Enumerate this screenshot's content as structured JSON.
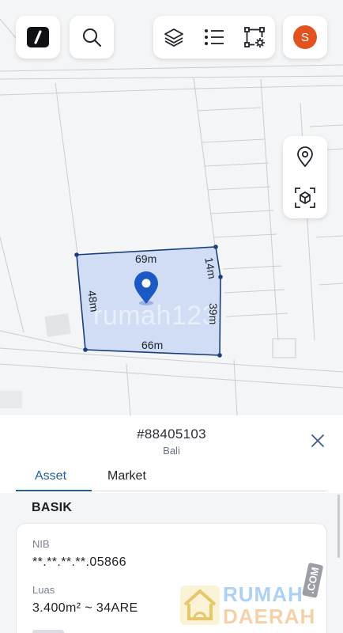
{
  "header": {
    "avatar_initial": "S",
    "icons": [
      "logo-icon",
      "search-icon",
      "layers-icon",
      "list-icon",
      "polygon-settings-icon"
    ]
  },
  "map": {
    "watermark": "rumah123",
    "plot": {
      "side_top": "69m",
      "side_top_right": "14m",
      "side_right": "39m",
      "side_bottom": "66m",
      "side_left": "48m"
    },
    "side_tools": [
      "location-pin-icon",
      "3d-box-icon"
    ]
  },
  "sheet": {
    "parcel_id": "#88405103",
    "region": "Bali",
    "tabs": [
      {
        "label": "Asset",
        "active": true
      },
      {
        "label": "Market",
        "active": false
      }
    ],
    "section_title": "BASIK",
    "fields": [
      {
        "label": "NIB",
        "value": "**.**.**.**.05866"
      },
      {
        "label": "Luas",
        "value": "3.400m² ~ 34ARE"
      }
    ]
  },
  "logo_watermark": {
    "line1": "RUMAH",
    "line2": "DAERAH",
    "suffix": ".COM"
  },
  "colors": {
    "accent": "#1f5f9e",
    "plot_fill": "#c9d8f5",
    "pin": "#1d59c4",
    "avatar": "#e2531f"
  }
}
